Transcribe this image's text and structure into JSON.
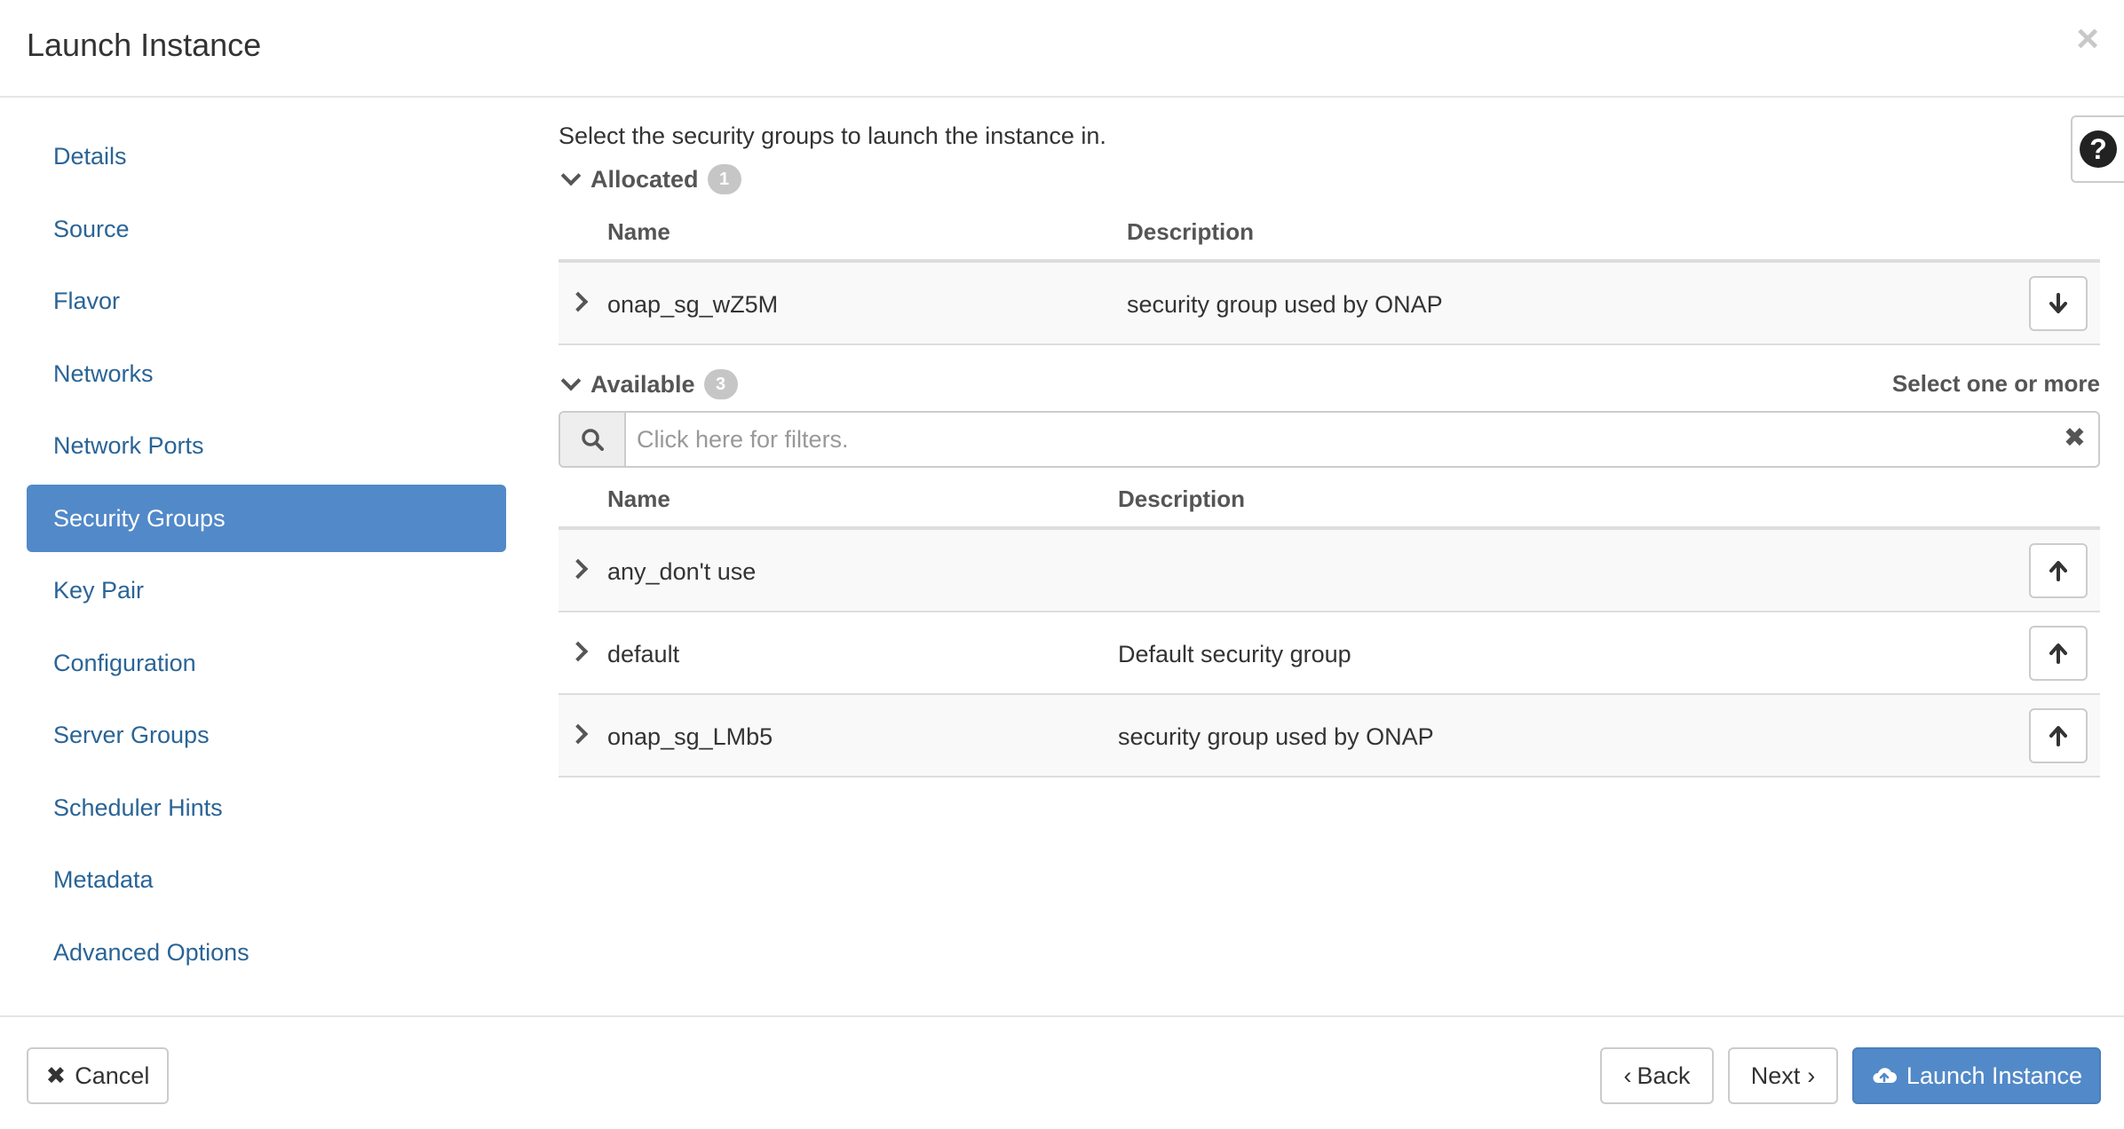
{
  "modal": {
    "title": "Launch Instance",
    "close_icon": "close-icon"
  },
  "sidebar": {
    "items": [
      {
        "label": "Details",
        "active": false
      },
      {
        "label": "Source",
        "active": false
      },
      {
        "label": "Flavor",
        "active": false
      },
      {
        "label": "Networks",
        "active": false
      },
      {
        "label": "Network Ports",
        "active": false
      },
      {
        "label": "Security Groups",
        "active": true
      },
      {
        "label": "Key Pair",
        "active": false
      },
      {
        "label": "Configuration",
        "active": false
      },
      {
        "label": "Server Groups",
        "active": false
      },
      {
        "label": "Scheduler Hints",
        "active": false
      },
      {
        "label": "Metadata",
        "active": false
      },
      {
        "label": "Advanced Options",
        "active": false
      }
    ]
  },
  "main": {
    "intro": "Select the security groups to launch the instance in.",
    "allocated": {
      "title": "Allocated",
      "count": "1",
      "headers": {
        "name": "Name",
        "description": "Description"
      },
      "rows": [
        {
          "name": "onap_sg_wZ5M",
          "description": "security group used by ONAP",
          "action_icon": "arrow-down-icon"
        }
      ]
    },
    "available": {
      "title": "Available",
      "count": "3",
      "select_hint": "Select one or more",
      "filter_placeholder": "Click here for filters.",
      "headers": {
        "name": "Name",
        "description": "Description"
      },
      "rows": [
        {
          "name": "any_don't use",
          "description": "",
          "action_icon": "arrow-up-icon"
        },
        {
          "name": "default",
          "description": "Default security group",
          "action_icon": "arrow-up-icon"
        },
        {
          "name": "onap_sg_LMb5",
          "description": "security group used by ONAP",
          "action_icon": "arrow-up-icon"
        }
      ]
    }
  },
  "footer": {
    "cancel_label": "Cancel",
    "back_label": "Back",
    "next_label": "Next",
    "launch_label": "Launch Instance"
  },
  "colors": {
    "primary": "#5289c8",
    "link": "#2a6496",
    "badge": "#c6c6c6"
  }
}
